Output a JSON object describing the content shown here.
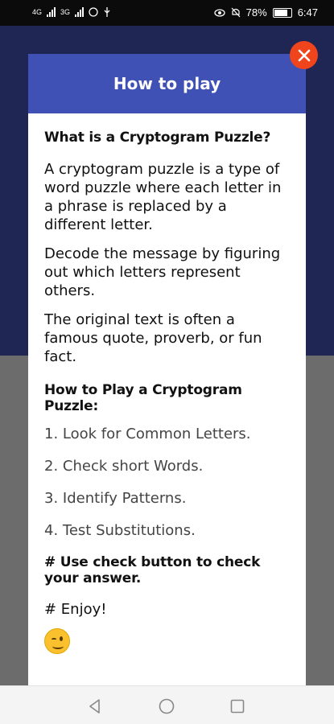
{
  "status_bar": {
    "left_indicators": [
      "4G",
      "3G"
    ],
    "battery": "78%",
    "time": "6:47"
  },
  "dialog": {
    "title": "How to play",
    "heading_what": "What is a Cryptogram Puzzle?",
    "paragraphs": [
      "A cryptogram puzzle is a type of word puzzle where each letter in a phrase is replaced by a different letter.",
      "Decode the message by figuring out which letters represent others.",
      "The original text is often a famous quote, proverb, or fun fact."
    ],
    "heading_how": "How to Play a Cryptogram Puzzle:",
    "steps": [
      "1. Look for Common Letters.",
      "2. Check short Words.",
      "3. Identify Patterns.",
      "4. Test Substitutions."
    ],
    "note": "#  Use check button to check your answer.",
    "enjoy": "# Enjoy!",
    "emoji": "winking-face"
  },
  "icons": {
    "close": "close-icon",
    "nav_back": "back-triangle-icon",
    "nav_home": "home-circle-icon",
    "nav_recents": "recents-square-icon"
  },
  "colors": {
    "header": "#3f51b5",
    "close_button": "#f0441d",
    "background_top": "#1f2654",
    "background_bottom": "#6c6c6c"
  }
}
